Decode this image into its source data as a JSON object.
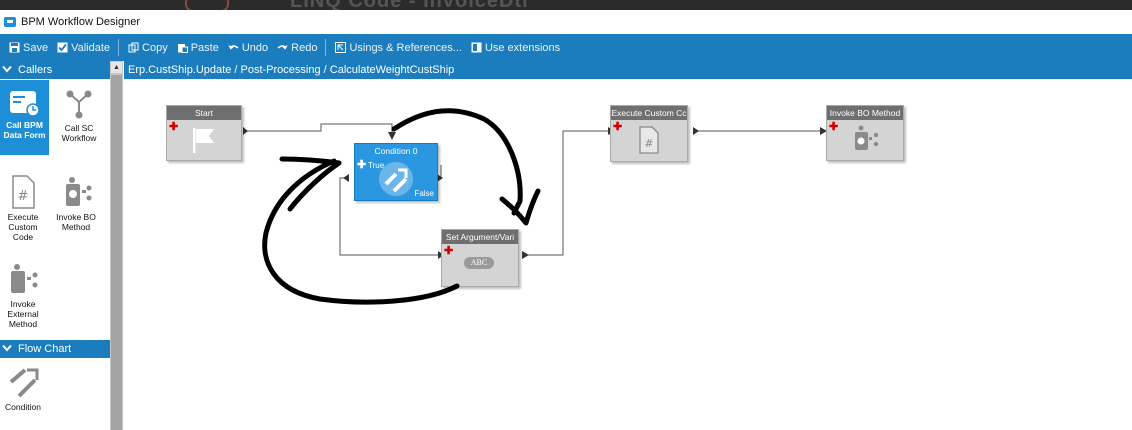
{
  "window": {
    "background_title": "LINQ Code - InvoiceDtl",
    "title": "BPM Workflow Designer"
  },
  "toolbar": {
    "items": [
      {
        "label": "Save",
        "icon": "save-icon"
      },
      {
        "label": "Validate",
        "icon": "checkbox-icon"
      },
      {
        "label": "Copy",
        "icon": "copy-icon"
      },
      {
        "label": "Paste",
        "icon": "paste-icon"
      },
      {
        "label": "Undo",
        "icon": "undo-icon"
      },
      {
        "label": "Redo",
        "icon": "redo-icon"
      },
      {
        "label": "Usings & References...",
        "icon": "references-icon"
      },
      {
        "label": "Use extensions",
        "icon": "extensions-icon"
      }
    ]
  },
  "palette": {
    "callers_header": "Callers",
    "tools": [
      {
        "label": "Call BPM Data Form",
        "icon": "data-form-icon",
        "selected": true
      },
      {
        "label": "Call SC Workflow",
        "icon": "workflow-icon",
        "selected": false
      },
      {
        "label": "Execute Custom Code",
        "icon": "custom-code-icon",
        "selected": false
      },
      {
        "label": "Invoke BO Method",
        "icon": "bo-method-icon",
        "selected": false
      },
      {
        "label": "Invoke External Method",
        "icon": "external-method-icon",
        "selected": false
      }
    ],
    "flowchart_header": "Flow Chart",
    "flow_tools": [
      {
        "label": "Condition",
        "icon": "condition-icon"
      }
    ]
  },
  "canvas": {
    "breadcrumb": "Erp.CustShip.Update / Post-Processing / CalculateWeightCustShip",
    "nodes": {
      "start": {
        "title": "Start"
      },
      "condition": {
        "title": "Condition 0",
        "true_label": "True",
        "false_label": "False"
      },
      "set_argument": {
        "title": "Set Argument/Vari",
        "badge": "ABC"
      },
      "execute_custom": {
        "title": "Execute Custom Cc"
      },
      "invoke_bo": {
        "title": "Invoke BO Method"
      }
    }
  },
  "colors": {
    "accent": "#1b7dbe",
    "selected_tool": "#1e8fd6",
    "node_body": "#d4d4d4",
    "node_header": "#6f6f6f",
    "condition_node": "#2a97e0",
    "add_marker": "#d10000",
    "annotation_ink": "#000000"
  }
}
